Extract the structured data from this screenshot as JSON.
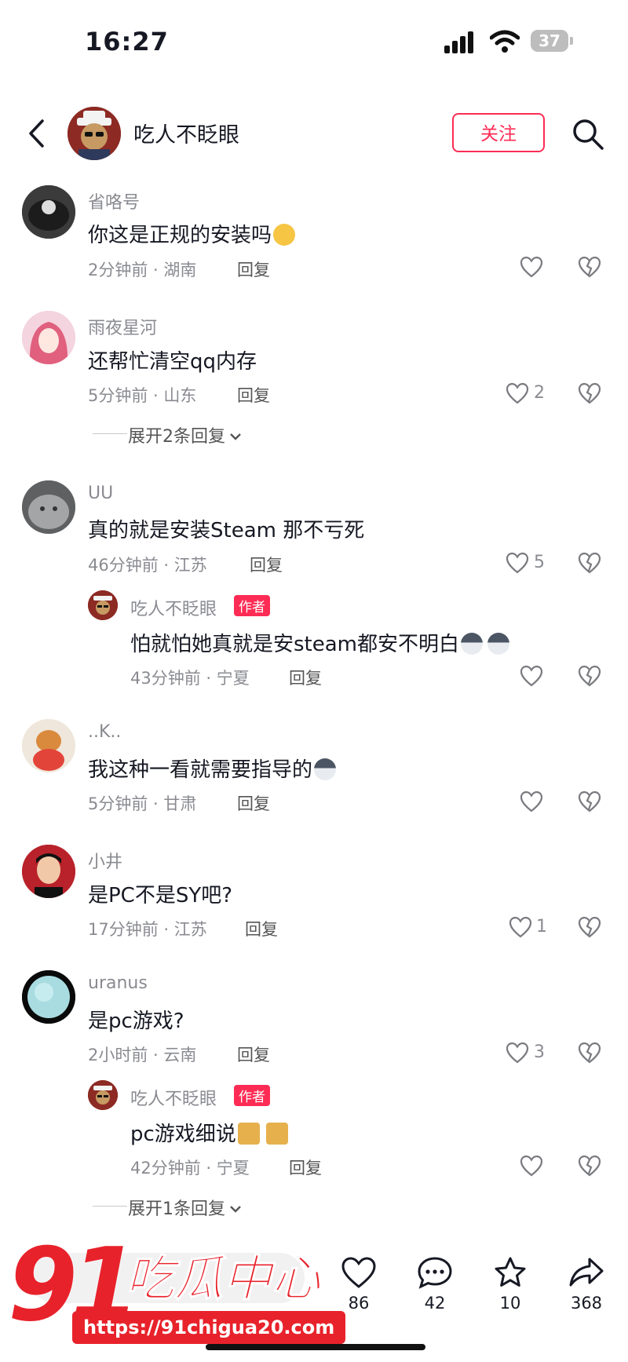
{
  "status_bar": {
    "time": "16:27",
    "battery": "37"
  },
  "header": {
    "title": "吃人不眨眼",
    "follow_label": "关注"
  },
  "comments": [
    {
      "username": "省咯号",
      "text": "你这是正规的安装吗",
      "time": "2分钟前",
      "location": "湖南",
      "reply_label": "回复",
      "likes": ""
    },
    {
      "username": "雨夜星河",
      "text": "还帮忙清空qq内存",
      "time": "5分钟前",
      "location": "山东",
      "reply_label": "回复",
      "likes": "2",
      "expand": "展开2条回复"
    },
    {
      "username": "UU",
      "text": "真的就是安装Steam 那不亏死",
      "time": "46分钟前",
      "location": "江苏",
      "reply_label": "回复",
      "likes": "5",
      "reply": {
        "username": "吃人不眨眼",
        "badge": "作者",
        "text": "怕就怕她真就是安steam都安不明白",
        "time": "43分钟前",
        "location": "宁夏",
        "reply_label": "回复",
        "likes": ""
      }
    },
    {
      "username": "..K..",
      "text": "我这种一看就需要指导的",
      "time": "5分钟前",
      "location": "甘肃",
      "reply_label": "回复",
      "likes": ""
    },
    {
      "username": "小井",
      "text": "是PC不是SY吧?",
      "time": "17分钟前",
      "location": "江苏",
      "reply_label": "回复",
      "likes": "1"
    },
    {
      "username": "uranus",
      "text": "是pc游戏?",
      "time": "2小时前",
      "location": "云南",
      "reply_label": "回复",
      "likes": "3",
      "reply": {
        "username": "吃人不眨眼",
        "badge": "作者",
        "text": "pc游戏细说",
        "time": "42分钟前",
        "location": "宁夏",
        "reply_label": "回复",
        "likes": ""
      },
      "expand": "展开1条回复"
    }
  ],
  "bottom_bar": {
    "likes": "86",
    "comments": "42",
    "favorites": "10",
    "shares": "368"
  },
  "watermark": {
    "number": "91",
    "name": "吃瓜中心",
    "url": "https://91chigua20.com"
  },
  "icons": [
    "back-icon",
    "search-icon",
    "heart-icon",
    "dislike-icon",
    "chevron-down-icon",
    "comment-icon",
    "star-icon",
    "share-icon"
  ],
  "colors": {
    "accent": "#fe2c55",
    "watermark": "#e8222b",
    "meta": "#8a8b91"
  }
}
